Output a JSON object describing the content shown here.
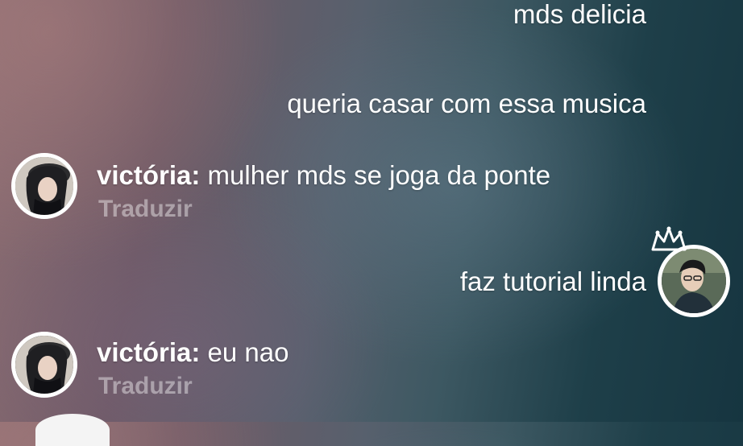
{
  "messages": [
    {
      "text": "mds delicia"
    },
    {
      "text": "queria casar com essa musica"
    },
    {
      "sender": "victória:",
      "text": "mulher mds se joga da ponte",
      "translate": "Traduzir"
    },
    {
      "text": "faz tutorial linda"
    },
    {
      "sender": "victória:",
      "text": "eu nao",
      "translate": "Traduzir"
    }
  ],
  "icons": {
    "crown": "crown-icon",
    "avatar_female": "avatar-victoria",
    "avatar_host": "avatar-host"
  },
  "colors": {
    "text": "#ffffff",
    "translate": "rgba(255,255,255,0.42)",
    "avatar_ring": "#ffffff"
  }
}
